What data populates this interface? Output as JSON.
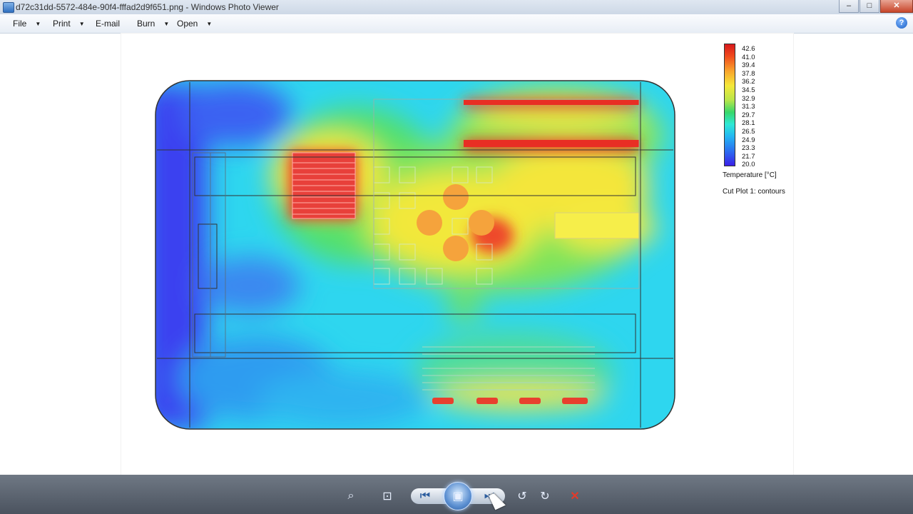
{
  "window": {
    "title": "d72c31dd-5572-484e-90f4-fffad2d9f651.png - Windows Photo Viewer",
    "controls": [
      "minimize",
      "maximize",
      "close"
    ]
  },
  "menu": {
    "items": [
      {
        "label": "File",
        "has_dropdown": true
      },
      {
        "label": "Print",
        "has_dropdown": true
      },
      {
        "label": "E-mail",
        "has_dropdown": false
      },
      {
        "label": "Burn",
        "has_dropdown": true
      },
      {
        "label": "Open",
        "has_dropdown": true
      }
    ],
    "help_symbol": "?"
  },
  "legend": {
    "ticks": [
      "42.6",
      "41.0",
      "39.4",
      "37.8",
      "36.2",
      "34.5",
      "32.9",
      "31.3",
      "29.7",
      "28.1",
      "26.5",
      "24.9",
      "23.3",
      "21.7",
      "20.0"
    ],
    "title": "Temperature [°C]",
    "subtitle": "Cut Plot 1: contours",
    "colors": {
      "max": "#d7191c",
      "mid": "#f5e83a",
      "low": "#2ee8d6",
      "min": "#3a20e8"
    }
  },
  "toolbar": {
    "buttons": [
      {
        "name": "zoom-icon",
        "glyph": "⌕"
      },
      {
        "name": "actual-size-icon",
        "glyph": "⊡"
      },
      {
        "name": "previous-icon",
        "glyph": "⏮"
      },
      {
        "name": "slideshow-icon",
        "glyph": "▣"
      },
      {
        "name": "next-icon",
        "glyph": "⏭"
      },
      {
        "name": "rotate-left-icon",
        "glyph": "↺"
      },
      {
        "name": "rotate-right-icon",
        "glyph": "↻"
      },
      {
        "name": "delete-icon",
        "glyph": "✕"
      }
    ]
  }
}
